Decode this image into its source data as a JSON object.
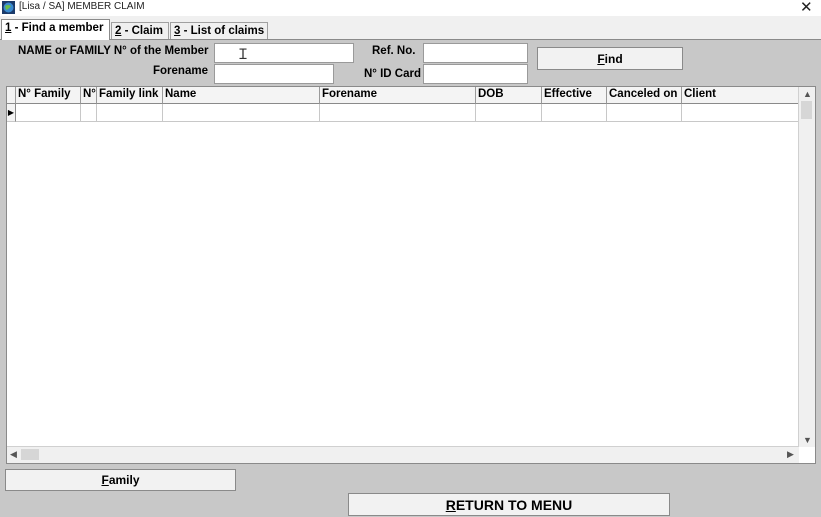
{
  "window": {
    "title": "[Lisa / SA] MEMBER CLAIM",
    "close_glyph": "✕"
  },
  "tabs": [
    {
      "hotkey": "1",
      "label": " - Find a member",
      "active": true
    },
    {
      "hotkey": "2",
      "label": " - Claim",
      "active": false
    },
    {
      "hotkey": "3",
      "label": " - List of claims",
      "active": false
    }
  ],
  "search": {
    "name_label": "NAME or FAMILY N° of the Member",
    "name_value": "",
    "forename_label": "Forename",
    "forename_value": "",
    "ref_label": "Ref. No.",
    "ref_value": "",
    "idcard_label": "N° ID Card",
    "idcard_value": "",
    "find_hotkey": "F",
    "find_rest": "ind"
  },
  "grid": {
    "columns": [
      "N° Family",
      "N°",
      "Family link",
      "Name",
      "Forename",
      "DOB",
      "Effective",
      "Canceled on",
      "Client"
    ],
    "row_indicator": "▶",
    "rows": []
  },
  "footer": {
    "family_hotkey": "F",
    "family_rest": "amily",
    "return_hotkey": "R",
    "return_rest": "ETURN TO MENU"
  },
  "colors": {
    "panel": "#c8c8c8",
    "grid_bg": "#ffffff"
  }
}
